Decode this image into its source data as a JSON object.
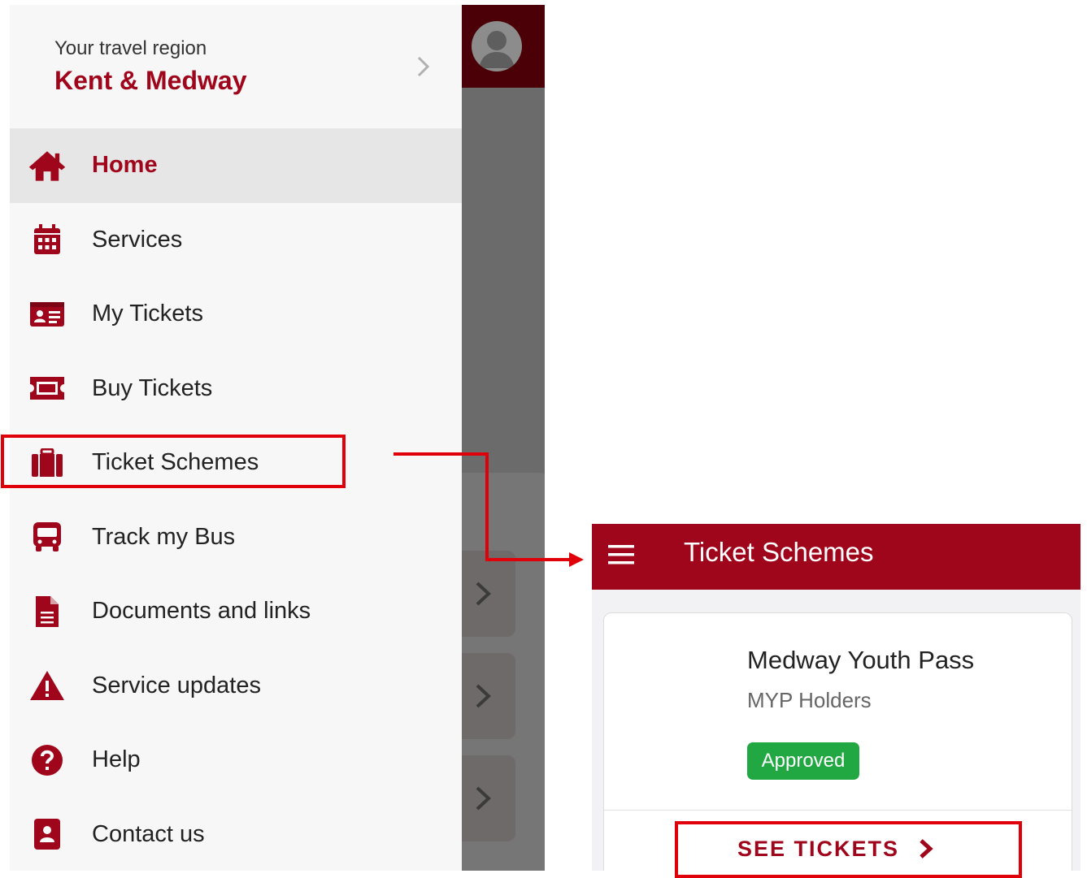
{
  "drawer": {
    "region_label": "Your travel region",
    "region_name": "Kent & Medway",
    "items": [
      {
        "label": "Home",
        "icon": "home-icon",
        "active": true
      },
      {
        "label": "Services",
        "icon": "calendar-icon"
      },
      {
        "label": "My Tickets",
        "icon": "id-card-icon"
      },
      {
        "label": "Buy Tickets",
        "icon": "ticket-icon"
      },
      {
        "label": "Ticket Schemes",
        "icon": "briefcase-icon"
      },
      {
        "label": "Track my Bus",
        "icon": "bus-icon"
      },
      {
        "label": "Documents and links",
        "icon": "document-icon"
      },
      {
        "label": "Service updates",
        "icon": "warning-icon"
      },
      {
        "label": "Help",
        "icon": "help-icon"
      },
      {
        "label": "Contact us",
        "icon": "contact-card-icon"
      }
    ]
  },
  "schemes": {
    "title": "Ticket Schemes",
    "card": {
      "name": "Medway Youth Pass",
      "subtitle": "MYP Holders",
      "status": "Approved",
      "action": "SEE TICKETS"
    }
  },
  "colors": {
    "brand": "#a0061b",
    "highlight": "#e0000a",
    "approved": "#22a843"
  }
}
